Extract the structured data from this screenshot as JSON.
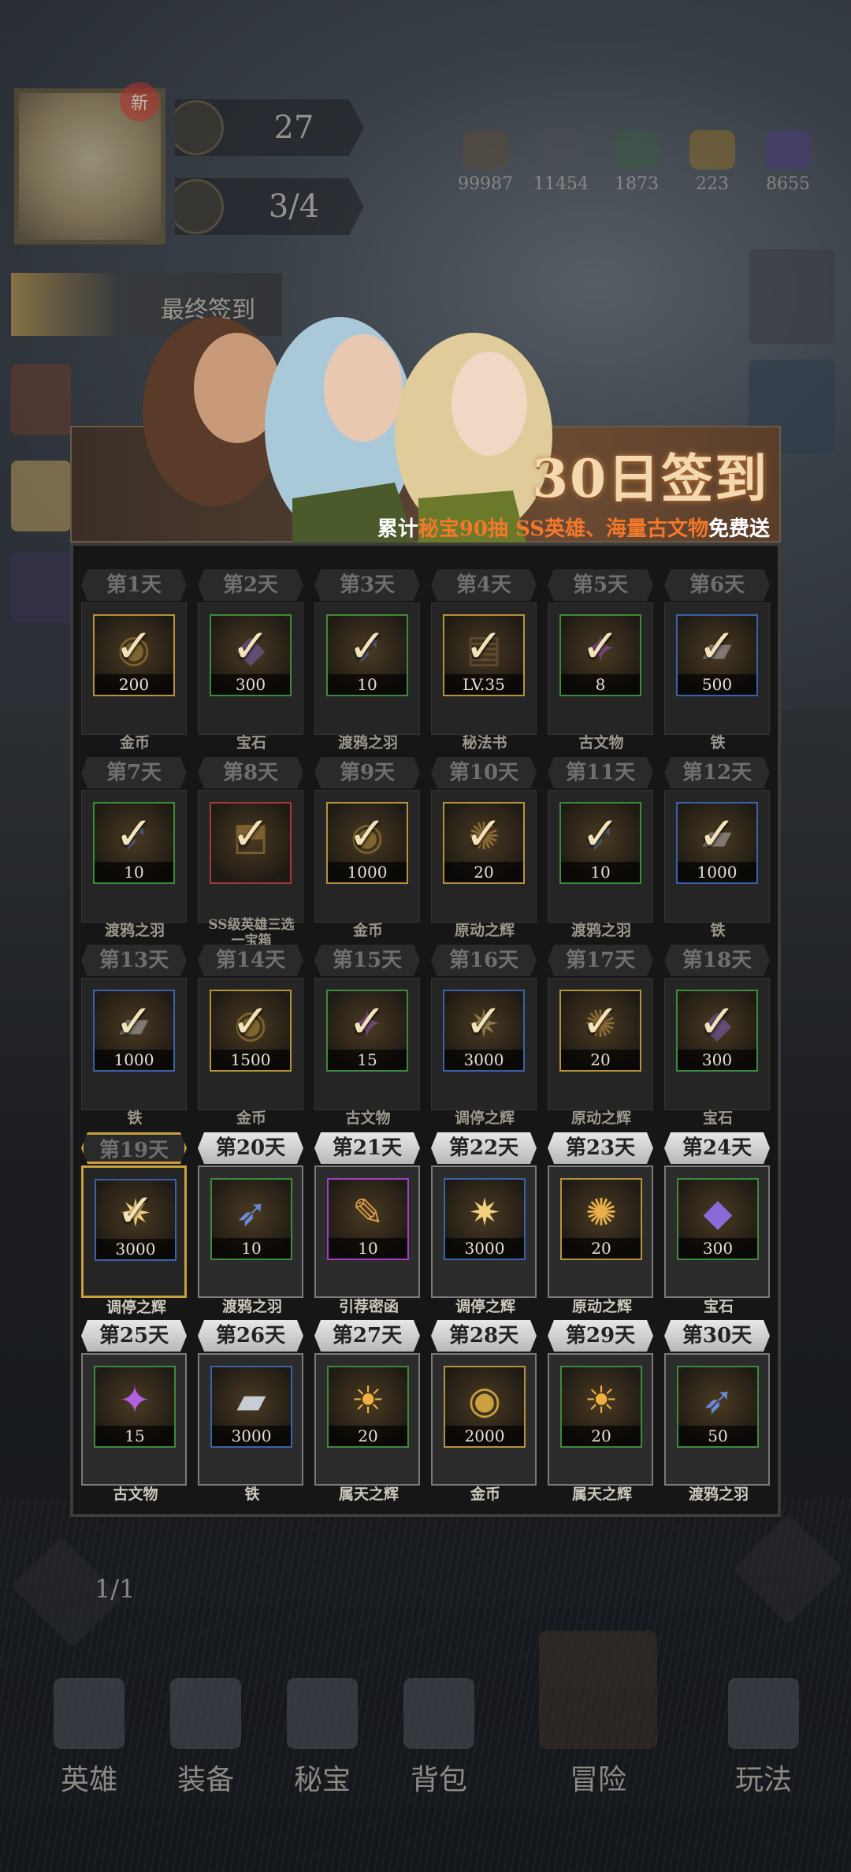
{
  "hud": {
    "level": "27",
    "energy": "3/4",
    "avatar_badge": "新",
    "resources": [
      "99987",
      "11454",
      "1873",
      "223",
      "8655"
    ],
    "left_banner": "最终签到",
    "bottom_counter": "1/1"
  },
  "bottom_nav": [
    "英雄",
    "装备",
    "秘宝",
    "背包",
    "冒险",
    "玩法"
  ],
  "modal": {
    "title": "30日签到",
    "subtitle_pre": "累计",
    "subtitle_hl1": "秘宝90抽",
    "subtitle_hl2": "SS英雄、海量古文物",
    "subtitle_post": "免费送"
  },
  "days": [
    {
      "day": "第1天",
      "amount": "200",
      "name": "金币",
      "status": "past",
      "quality": "gold",
      "icon": "coin-icon"
    },
    {
      "day": "第2天",
      "amount": "300",
      "name": "宝石",
      "status": "past",
      "quality": "green",
      "icon": "gem-icon"
    },
    {
      "day": "第3天",
      "amount": "10",
      "name": "渡鸦之羽",
      "status": "past",
      "quality": "green",
      "icon": "feather-icon"
    },
    {
      "day": "第4天",
      "amount": "LV.35",
      "name": "秘法书",
      "status": "past",
      "quality": "gold",
      "icon": "book-icon"
    },
    {
      "day": "第5天",
      "amount": "8",
      "name": "古文物",
      "status": "past",
      "quality": "green",
      "icon": "relic-icon"
    },
    {
      "day": "第6天",
      "amount": "500",
      "name": "铁",
      "status": "past",
      "quality": "blue",
      "icon": "iron-icon"
    },
    {
      "day": "第7天",
      "amount": "10",
      "name": "渡鸦之羽",
      "status": "past",
      "quality": "green",
      "icon": "feather-icon"
    },
    {
      "day": "第8天",
      "amount": "",
      "name": "SS级英雄三选一宝箱",
      "status": "past",
      "quality": "red",
      "icon": "chest-icon"
    },
    {
      "day": "第9天",
      "amount": "1000",
      "name": "金币",
      "status": "past",
      "quality": "gold",
      "icon": "coin-icon"
    },
    {
      "day": "第10天",
      "amount": "20",
      "name": "原动之辉",
      "status": "past",
      "quality": "gold",
      "icon": "orb-icon"
    },
    {
      "day": "第11天",
      "amount": "10",
      "name": "渡鸦之羽",
      "status": "past",
      "quality": "green",
      "icon": "feather-icon"
    },
    {
      "day": "第12天",
      "amount": "1000",
      "name": "铁",
      "status": "past",
      "quality": "blue",
      "icon": "iron-icon"
    },
    {
      "day": "第13天",
      "amount": "1000",
      "name": "铁",
      "status": "past",
      "quality": "blue",
      "icon": "iron-icon"
    },
    {
      "day": "第14天",
      "amount": "1500",
      "name": "金币",
      "status": "past",
      "quality": "gold",
      "icon": "coin-icon"
    },
    {
      "day": "第15天",
      "amount": "15",
      "name": "古文物",
      "status": "past",
      "quality": "green",
      "icon": "relic-icon"
    },
    {
      "day": "第16天",
      "amount": "3000",
      "name": "调停之辉",
      "status": "past",
      "quality": "blue",
      "icon": "star-orb-icon"
    },
    {
      "day": "第17天",
      "amount": "20",
      "name": "原动之辉",
      "status": "past",
      "quality": "gold",
      "icon": "orb-icon"
    },
    {
      "day": "第18天",
      "amount": "300",
      "name": "宝石",
      "status": "past",
      "quality": "green",
      "icon": "gem-icon"
    },
    {
      "day": "第19天",
      "amount": "3000",
      "name": "调停之辉",
      "status": "today",
      "quality": "blue",
      "icon": "star-orb-icon"
    },
    {
      "day": "第20天",
      "amount": "10",
      "name": "渡鸦之羽",
      "status": "future",
      "quality": "green",
      "icon": "feather-icon"
    },
    {
      "day": "第21天",
      "amount": "10",
      "name": "引荐密函",
      "status": "future",
      "quality": "purple",
      "icon": "scroll-icon"
    },
    {
      "day": "第22天",
      "amount": "3000",
      "name": "调停之辉",
      "status": "future",
      "quality": "blue",
      "icon": "star-orb-icon"
    },
    {
      "day": "第23天",
      "amount": "20",
      "name": "原动之辉",
      "status": "future",
      "quality": "gold",
      "icon": "orb-icon"
    },
    {
      "day": "第24天",
      "amount": "300",
      "name": "宝石",
      "status": "future",
      "quality": "green",
      "icon": "gem-icon"
    },
    {
      "day": "第25天",
      "amount": "15",
      "name": "古文物",
      "status": "future",
      "quality": "green",
      "icon": "relic-icon"
    },
    {
      "day": "第26天",
      "amount": "3000",
      "name": "铁",
      "status": "future",
      "quality": "blue",
      "icon": "iron-icon"
    },
    {
      "day": "第27天",
      "amount": "20",
      "name": "属天之辉",
      "status": "future",
      "quality": "green",
      "icon": "sun-orb-icon"
    },
    {
      "day": "第28天",
      "amount": "2000",
      "name": "金币",
      "status": "future",
      "quality": "gold",
      "icon": "coin-icon"
    },
    {
      "day": "第29天",
      "amount": "20",
      "name": "属天之辉",
      "status": "future",
      "quality": "green",
      "icon": "sun-orb-icon"
    },
    {
      "day": "第30天",
      "amount": "50",
      "name": "渡鸦之羽",
      "status": "future",
      "quality": "green",
      "icon": "feather-icon"
    }
  ],
  "check_glyph": "✓"
}
